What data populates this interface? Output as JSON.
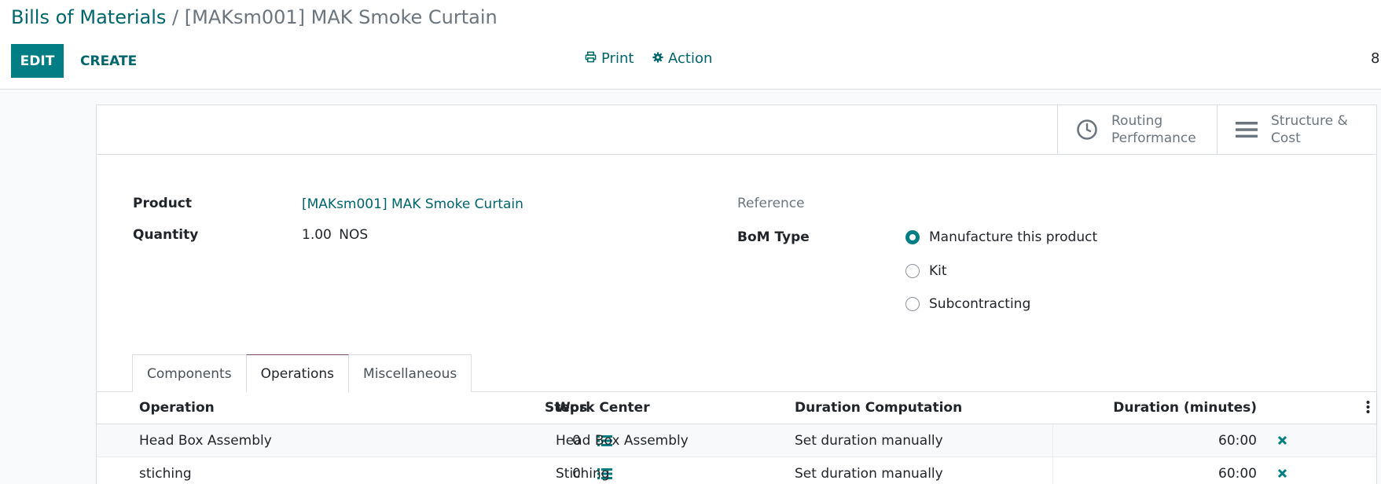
{
  "breadcrumb": {
    "parent": "Bills of Materials",
    "separator": "/",
    "current": "[MAKsm001] MAK Smoke Curtain"
  },
  "toolbar": {
    "edit_label": "EDIT",
    "create_label": "CREATE",
    "print_label": "Print",
    "action_label": "Action",
    "pager_text": "8"
  },
  "smart_buttons": [
    {
      "label": "Routing Performance",
      "icon": "clock-icon"
    },
    {
      "label": "Structure & Cost",
      "icon": "bars-icon"
    }
  ],
  "form": {
    "product_label": "Product",
    "product_value": "[MAKsm001] MAK Smoke Curtain",
    "quantity_label": "Quantity",
    "quantity_value": "1.00",
    "quantity_uom": "NOS",
    "reference_label": "Reference",
    "bom_type_label": "BoM Type",
    "bom_type_options": [
      {
        "label": "Manufacture this product",
        "checked": true
      },
      {
        "label": "Kit",
        "checked": false
      },
      {
        "label": "Subcontracting",
        "checked": false
      }
    ]
  },
  "tabs": [
    {
      "label": "Components",
      "active": false
    },
    {
      "label": "Operations",
      "active": true
    },
    {
      "label": "Miscellaneous",
      "active": false
    }
  ],
  "operations_table": {
    "columns": [
      "Operation",
      "Steps",
      "Work Center",
      "Duration Computation",
      "Duration (minutes)"
    ],
    "rows": [
      {
        "operation": "Head Box Assembly",
        "steps": "0",
        "work_center": "Head Box Assembly",
        "duration_computation": "Set duration manually",
        "duration": "60:00"
      },
      {
        "operation": "stiching",
        "steps": "0",
        "work_center": "Stiching",
        "duration_computation": "Set duration manually",
        "duration": "60:00"
      }
    ]
  },
  "colors": {
    "primary": "#017e84",
    "link": "#01666b",
    "muted": "#6c757d"
  }
}
